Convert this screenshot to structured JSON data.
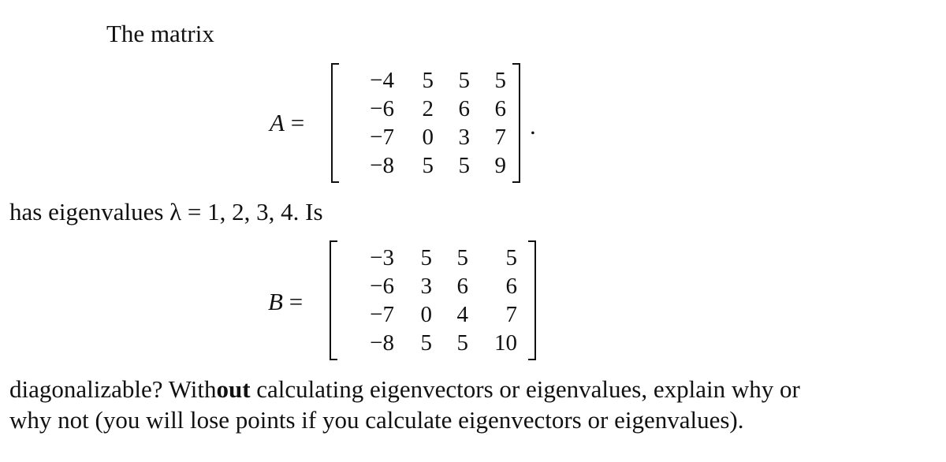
{
  "intro": "The matrix",
  "matrix_a": {
    "label": "A",
    "equals": "=",
    "rows": [
      [
        "−4",
        "5",
        "5",
        "5"
      ],
      [
        "−6",
        "2",
        "6",
        "6"
      ],
      [
        "−7",
        "0",
        "3",
        "7"
      ],
      [
        "−8",
        "5",
        "5",
        "9"
      ]
    ],
    "trailing": "."
  },
  "eigen_line": "has eigenvalues λ = 1, 2, 3, 4. Is",
  "matrix_b": {
    "label": "B",
    "equals": "=",
    "rows": [
      [
        "−3",
        "5",
        "5",
        "5"
      ],
      [
        "−6",
        "3",
        "6",
        "6"
      ],
      [
        "−7",
        "0",
        "4",
        "7"
      ],
      [
        "−8",
        "5",
        "5",
        "10"
      ]
    ]
  },
  "question": {
    "line1_pre": "diagonalizable? With",
    "line1_bold": "out",
    "line1_post": " calculating eigenvectors or eigenvalues, explain why or",
    "line2": "why not (you will lose points if you calculate eigenvectors or eigenvalues)."
  }
}
